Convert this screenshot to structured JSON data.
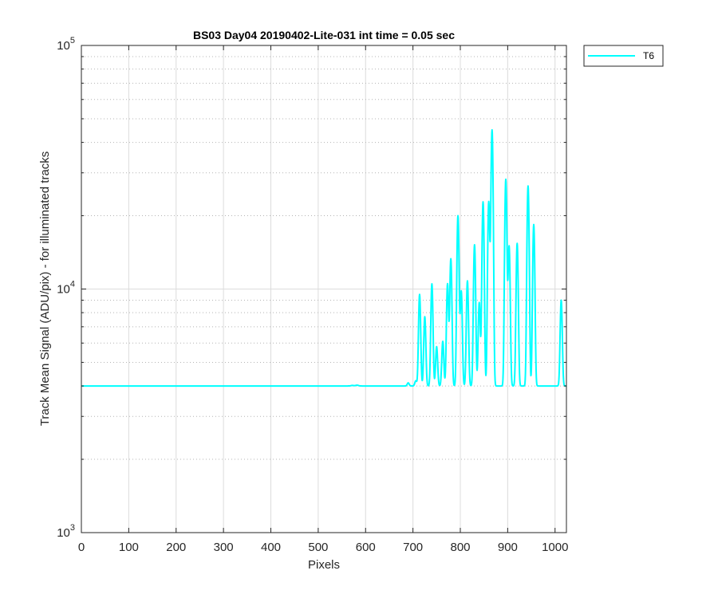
{
  "chart_data": {
    "type": "line",
    "title": "BS03 Day04 20190402-Lite-031 int time = 0.05 sec",
    "xlabel": "Pixels",
    "ylabel": "Track Mean Signal (ADU/pix) - for illuminated tracks",
    "xlim": [
      0,
      1024
    ],
    "ylim": [
      1000,
      100000
    ],
    "yscale": "log",
    "grid": true,
    "x_ticks": [
      "0",
      "100",
      "200",
      "300",
      "400",
      "500",
      "600",
      "700",
      "800",
      "900",
      "1000"
    ],
    "y_ticks": [
      {
        "base": "10",
        "exp": "3"
      },
      {
        "base": "10",
        "exp": "4"
      },
      {
        "base": "10",
        "exp": "5"
      }
    ],
    "legend": {
      "location": "outside-top-right"
    },
    "colors": {
      "series": "#00ffff",
      "axes": "#262626",
      "grid": "#dcdcdc"
    },
    "series": [
      {
        "name": "T6",
        "baseline": 4000,
        "peaks": [
          {
            "x": 572,
            "y": 4020,
            "w": 3
          },
          {
            "x": 582,
            "y": 4030,
            "w": 3
          },
          {
            "x": 690,
            "y": 4120,
            "w": 2
          },
          {
            "x": 706,
            "y": 4200,
            "w": 2
          },
          {
            "x": 714,
            "y": 9500,
            "w": 2
          },
          {
            "x": 725,
            "y": 7700,
            "w": 2
          },
          {
            "x": 740,
            "y": 10500,
            "w": 2
          },
          {
            "x": 750,
            "y": 5800,
            "w": 2
          },
          {
            "x": 763,
            "y": 6100,
            "w": 2
          },
          {
            "x": 773,
            "y": 10500,
            "w": 2
          },
          {
            "x": 780,
            "y": 13300,
            "w": 2
          },
          {
            "x": 795,
            "y": 20000,
            "w": 2
          },
          {
            "x": 802,
            "y": 9800,
            "w": 2
          },
          {
            "x": 815,
            "y": 10800,
            "w": 2
          },
          {
            "x": 830,
            "y": 15200,
            "w": 2
          },
          {
            "x": 840,
            "y": 8800,
            "w": 2
          },
          {
            "x": 848,
            "y": 22800,
            "w": 2
          },
          {
            "x": 860,
            "y": 22800,
            "w": 2
          },
          {
            "x": 867,
            "y": 45000,
            "w": 2
          },
          {
            "x": 896,
            "y": 28200,
            "w": 2
          },
          {
            "x": 903,
            "y": 15000,
            "w": 2
          },
          {
            "x": 920,
            "y": 15400,
            "w": 2
          },
          {
            "x": 943,
            "y": 26500,
            "w": 2
          },
          {
            "x": 955,
            "y": 18400,
            "w": 2
          },
          {
            "x": 1013,
            "y": 9000,
            "w": 2
          }
        ]
      }
    ]
  }
}
